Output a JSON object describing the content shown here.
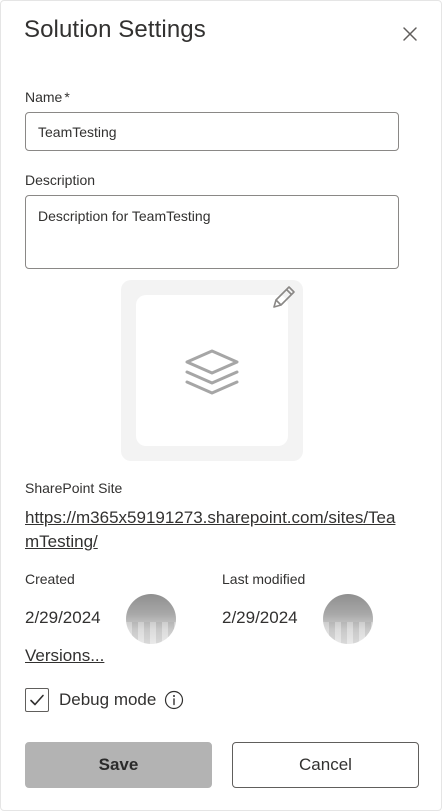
{
  "dialog": {
    "title": "Solution Settings",
    "close_icon": "close-icon"
  },
  "form": {
    "name_label": "Name",
    "name_required_marker": "*",
    "name_value": "TeamTesting",
    "description_label": "Description",
    "description_value": "Description for TeamTesting"
  },
  "solution_icon": {
    "icon": "layers-stack-icon",
    "edit_icon": "pencil-icon"
  },
  "sharepoint": {
    "label": "SharePoint Site",
    "url": "https://m365x59191273.sharepoint.com/sites/TeamTesting/"
  },
  "metadata": {
    "created_label": "Created",
    "created_date": "2/29/2024",
    "modified_label": "Last modified",
    "modified_date": "2/29/2024",
    "versions_link": "Versions..."
  },
  "debug": {
    "label": "Debug mode",
    "checked": true,
    "info_icon": "info-icon"
  },
  "actions": {
    "save_label": "Save",
    "cancel_label": "Cancel"
  },
  "colors": {
    "text": "#323130",
    "border": "#8a8886",
    "save_disabled_bg": "#b3b3b3",
    "icon_frame_bg": "#f3f3f3",
    "icon_gray": "#a6a6a6"
  }
}
